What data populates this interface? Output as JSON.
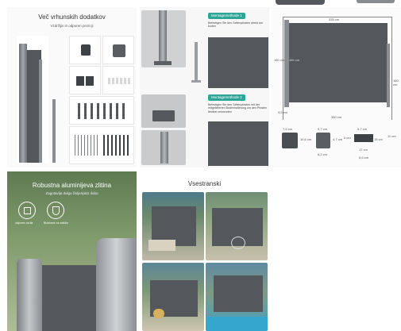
{
  "accessories": {
    "title": "Več vrhunskih dodatkov",
    "subtitle": "Vzdržljiv in odporen proti rji"
  },
  "mounting": {
    "badges": [
      "1",
      "2"
    ],
    "method1": {
      "label": "Montagemethode 1",
      "text": "Befestigen Sie den Seitenpfosten direkt am boden"
    },
    "method2": {
      "label": "Montagemethode 2",
      "text": "Befestigen Sie den Seitenpfosten mit der mitgelieferten Bodenhalterung um den Pfosten flexibel verwenden"
    }
  },
  "dimensions": {
    "width_total": "335 cm",
    "width_base": "350 cm",
    "height_panel": "160 cm",
    "height_left": "180 cm",
    "height_right": "160 cm",
    "offset": "9,5 cm",
    "part1_top": "7,5 cm",
    "part1_side": "10,6 cm",
    "part2_top": "9,7 cm",
    "part2_side": "4,7 cm",
    "part2_bottom": "6,2 cm",
    "part3_top": "9,7 cm",
    "part3_left": "5 cm",
    "part3_mid": "15 cm",
    "part3_right": "11 cm",
    "part3_bottom1": "17 cm",
    "part3_bottom2": "6,6 cm"
  },
  "aluminum": {
    "title": "Robustna aluminijeva zlitina",
    "subtitle": "Zagotavlja dolgo življenjsko dobo",
    "feature1": "odporen na tla",
    "feature2": "Blokirane za zaščito"
  },
  "versatile": {
    "title": "Vsestranski"
  },
  "colors": {
    "panel": "#54575b",
    "teal": "#2ea596",
    "post": "#8a8d91"
  }
}
